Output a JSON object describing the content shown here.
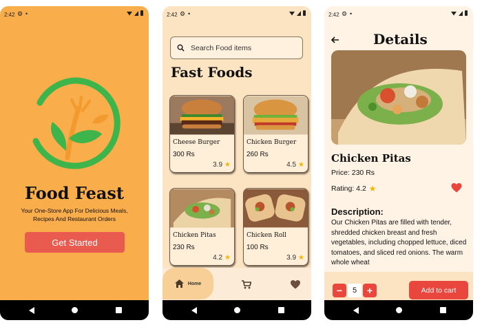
{
  "status_time": "2:42",
  "splash": {
    "app_name": "Food Feast",
    "tagline": "Your One-Store App For Delicious Meals, Recipes And Restaurant Orders",
    "cta": "Get Started",
    "bg_color": "#FAAD4B",
    "accent": "#E95A4F"
  },
  "home": {
    "search_placeholder": "Search Food items",
    "title": "Fast Foods",
    "items": [
      {
        "name": "Cheese Burger",
        "price": "300 Rs",
        "rating": "3.9"
      },
      {
        "name": "Chicken Burger",
        "price": "260 Rs",
        "rating": "4.5"
      },
      {
        "name": "Chicken Pitas",
        "price": "230 Rs",
        "rating": "4.2"
      },
      {
        "name": "Chicken Roll",
        "price": "100 Rs",
        "rating": "3.9"
      }
    ],
    "nav": {
      "home_label": "Home"
    }
  },
  "details": {
    "title": "Details",
    "name": "Chicken Pitas",
    "price": "Price:  230 Rs",
    "rating": "Rating: 4.2",
    "description_heading": "Description:",
    "description": "Our Chicken Pitas are filled with tender, shredded chicken breast and fresh vegetables, including chopped lettuce, diced tomatoes, and sliced red onions. The warm whole wheat",
    "quantity": "5",
    "minus": "−",
    "plus": "+",
    "add_to_cart": "Add to cart",
    "accent": "#E9463D"
  }
}
